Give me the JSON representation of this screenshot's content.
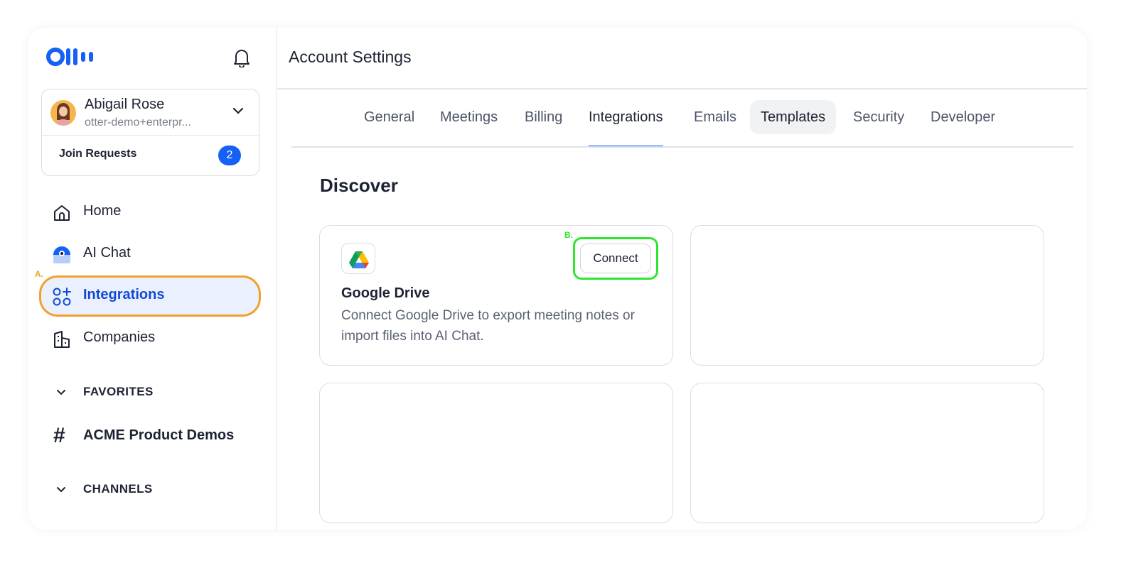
{
  "sidebar": {
    "account": {
      "name": "Abigail Rose",
      "email": "otter-demo+enterpr...",
      "join_requests_label": "Join Requests",
      "join_requests_count": "2"
    },
    "nav": [
      {
        "label": "Home",
        "icon": "home-icon"
      },
      {
        "label": "AI Chat",
        "icon": "ai-chat-icon"
      },
      {
        "label": "Integrations",
        "icon": "integrations-icon",
        "active": true
      },
      {
        "label": "Companies",
        "icon": "companies-icon"
      }
    ],
    "favorites_label": "FAVORITES",
    "channel": "ACME Product Demos",
    "channels_label": "CHANNELS"
  },
  "main": {
    "title": "Account Settings",
    "tabs": [
      "General",
      "Meetings",
      "Billing",
      "Integrations",
      "Emails",
      "Templates",
      "Security",
      "Developer"
    ],
    "active_tab": "Integrations",
    "section_title": "Discover",
    "card": {
      "title": "Google Drive",
      "description": "Connect Google Drive to export meeting notes or import files into AI Chat.",
      "button": "Connect"
    }
  },
  "annotations": {
    "a": "A.",
    "b": "B."
  },
  "colors": {
    "accent": "#1560f5",
    "highlight_a": "#f1a029",
    "highlight_b": "#2ee62e"
  }
}
